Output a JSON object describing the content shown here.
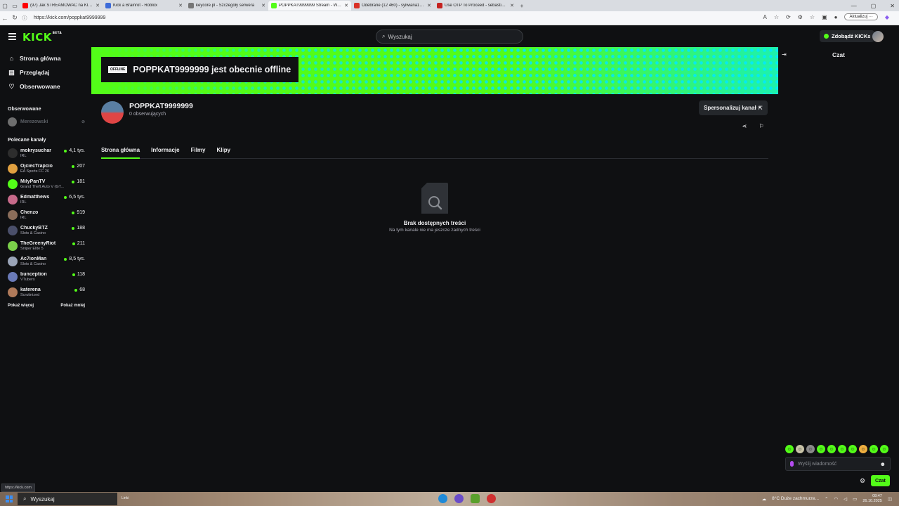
{
  "browser": {
    "tabs": [
      {
        "title": "(97) Jak STREAMOWAĆ na KICKU",
        "color": "#ff0000",
        "active": false
      },
      {
        "title": "Kick a Brainrot - Roblox",
        "color": "#3d6bd9",
        "active": false
      },
      {
        "title": "keycore.pl - Szczegóły serwera",
        "color": "#777777",
        "active": false
      },
      {
        "title": "POPPKAT9999999 Stream - Watch",
        "color": "#53fc18",
        "active": true
      },
      {
        "title": "Odebrane (12 460) - sylwiana18@",
        "color": "#d93025",
        "active": false
      },
      {
        "title": "Use OTP To Proceed - sebastian...",
        "color": "#c5221f",
        "active": false
      }
    ],
    "new_tab": "+",
    "url": "https://kick.com/poppkat9999999",
    "update_label": "Aktualizuj",
    "status_url": "https://kick.com"
  },
  "header": {
    "logo": "KICK",
    "logo_tag": "BETA",
    "search_placeholder": "Wyszukaj",
    "kicks_label": "Zdobądź KICKs"
  },
  "sidebar": {
    "nav": [
      {
        "label": "Strona główna",
        "icon": "home-icon"
      },
      {
        "label": "Przeglądaj",
        "icon": "browse-icon"
      },
      {
        "label": "Obserwowane",
        "icon": "heart-icon"
      }
    ],
    "followed_title": "Obserwowane",
    "followed": [
      {
        "name": "Merezowski"
      }
    ],
    "recommended_title": "Polecane kanały",
    "channels": [
      {
        "name": "mokrysuchar",
        "category": "IRL",
        "viewers": "4,1 tys.",
        "color": "#2d2d2d"
      },
      {
        "name": "OjciecTrapcio",
        "category": "EA Sports FC 26",
        "viewers": "207",
        "color": "#e0a040"
      },
      {
        "name": "MilyPanTV",
        "category": "Grand Theft Auto V (GT...",
        "viewers": "181",
        "color": "#53fc18"
      },
      {
        "name": "Edmatthews",
        "category": "IRL",
        "viewers": "6,5 tys.",
        "color": "#c76a8a"
      },
      {
        "name": "Chenzo",
        "category": "IRL",
        "viewers": "919",
        "color": "#8a6d5a"
      },
      {
        "name": "ChuckyBTZ",
        "category": "Slots & Casino",
        "viewers": "188",
        "color": "#4a4f6a"
      },
      {
        "name": "TheGreenyRiot",
        "category": "Sniper Elite 5",
        "viewers": "211",
        "color": "#7bd04a"
      },
      {
        "name": "Ac7ionMan",
        "category": "Slots & Casino",
        "viewers": "8,5 tys.",
        "color": "#9aa4b8"
      },
      {
        "name": "bunception",
        "category": "VTubers",
        "viewers": "118",
        "color": "#6a7ab8"
      },
      {
        "name": "katerena",
        "category": "Scrutinized",
        "viewers": "68",
        "color": "#b07a5a"
      }
    ],
    "show_more": "Pokaż więcej",
    "show_less": "Pokaż mniej"
  },
  "banner": {
    "badge": "OFFLINE",
    "text": "POPPKAT9999999 jest obecnie offline"
  },
  "channel": {
    "name": "POPPKAT9999999",
    "followers": "0 obserwujących",
    "customize_label": "Spersonalizuj kanał",
    "tabs": [
      "Strona główna",
      "Informacje",
      "Filmy",
      "Klipy"
    ],
    "empty_title": "Brak dostępnych treści",
    "empty_subtitle": "Na tym kanale nie ma jeszcze żadnych treści"
  },
  "chat": {
    "title": "Czat",
    "input_placeholder": "Wyślij wiadomość",
    "send_label": "Czat",
    "emote_colors": [
      "#53fc18",
      "#c9c4a8",
      "#8a8a8a",
      "#53fc18",
      "#53fc18",
      "#53fc18",
      "#53fc18",
      "#f0b040",
      "#53fc18",
      "#53fc18"
    ]
  },
  "taskbar": {
    "search_label": "Wyszukaj",
    "weather_short": "Linki",
    "weather": "8°C  Duże zachmurze...",
    "time": "08:47",
    "date": "26.10.2025"
  }
}
